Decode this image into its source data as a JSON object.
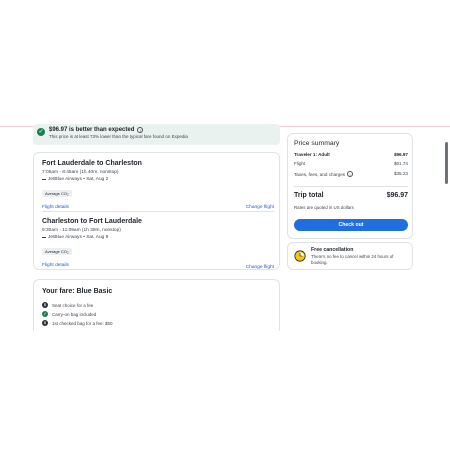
{
  "deal": {
    "title": "$96.97 is better than expected",
    "subtitle": "This price is at least 73% lower than the typical fare found on Expedia"
  },
  "legs": [
    {
      "route": "Fort Lauderdale to Charleston",
      "times": "7:05am - 8:45am (1h 40m, nonstop)",
      "airline": "JetBlue Airways • Sat, Aug 2",
      "badge": "Average CO₂",
      "details_link": "Flight details",
      "change_link": "Change flight"
    },
    {
      "route": "Charleston to Fort Lauderdale",
      "times": "9:30am - 11:09am (1h 39m, nonstop)",
      "airline": "JetBlue Airways • Sat, Aug 9",
      "badge": "Average CO₂",
      "details_link": "Flight details",
      "change_link": "Change flight"
    }
  ],
  "fare": {
    "title": "Your fare: Blue Basic",
    "features": [
      {
        "icon": "dollar-icon",
        "text": "Seat choice for a fee"
      },
      {
        "icon": "check-icon",
        "text": "Carry-on bag included"
      },
      {
        "icon": "dollar-icon",
        "text": "1st checked bag for a fee: $50"
      }
    ]
  },
  "price": {
    "title": "Price summary",
    "traveler_label": "Traveler 1: Adult",
    "traveler_value": "$96.97",
    "flight_label": "Flight",
    "flight_value": "$61.74",
    "taxes_label": "Taxes, fees, and charges",
    "taxes_value": "$35.23",
    "total_label": "Trip total",
    "total_value": "$96.97",
    "currency_note": "Rates are quoted in US dollars",
    "checkout_label": "Check out"
  },
  "cancellation": {
    "title": "Free cancellation",
    "text": "There's no fee to cancel within 24 hours of booking."
  },
  "colors": {
    "accent": "#1f6fe0",
    "link": "#1f5cd1",
    "success": "#1a7f53"
  }
}
